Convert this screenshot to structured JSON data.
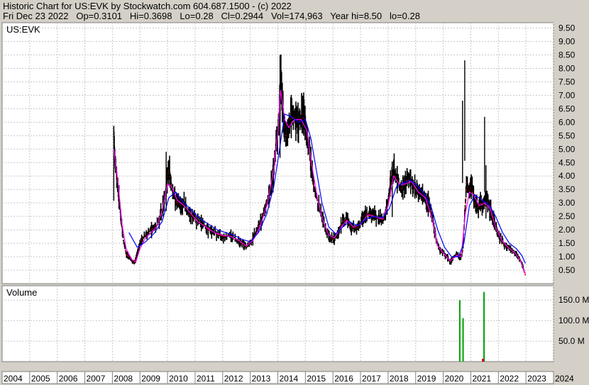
{
  "header": {
    "line1": "Historic Chart for US:EVK by Stockwatch.com 604.687.1500 - (c) 2022",
    "line2": "Fri Dec 23 2022   Op=0.3101   Hi=0.3698   Lo=0.28   Cl=0.2944   Vol=174,963   Year hi=8.50   lo=0.28"
  },
  "colors": {
    "background": "#d4d0c8",
    "plot_bg": "#ffffff",
    "grid": "#c8c8c8",
    "price_bars": "#000000",
    "ma_short": "#ff00ff",
    "ma_long": "#0000ff",
    "volume_bars": "#00a000"
  },
  "chart_data": [
    {
      "type": "line",
      "title": "US:EVK",
      "xlabel": "",
      "ylabel": "",
      "x_range": [
        2004.0,
        2024.0
      ],
      "ylim": [
        0,
        9.7
      ],
      "y_ticks": [
        0.5,
        1.0,
        1.5,
        2.0,
        2.5,
        3.0,
        3.5,
        4.0,
        4.5,
        5.0,
        5.5,
        6.0,
        6.5,
        7.0,
        7.5,
        8.0,
        8.5,
        9.0,
        9.5
      ],
      "y_tick_labels": [
        "0.50",
        "1.00",
        "1.50",
        "2.00",
        "2.50",
        "3.00",
        "3.50",
        "4.00",
        "4.50",
        "5.00",
        "5.50",
        "6.00",
        "6.50",
        "7.00",
        "7.50",
        "8.00",
        "8.50",
        "9.00",
        "9.50"
      ],
      "grid": true,
      "series": [
        {
          "name": "",
          "style": "hi-lo price bars",
          "color": "#000000",
          "points": [
            [
              2008.05,
              5.5
            ],
            [
              2008.12,
              4.3
            ],
            [
              2008.2,
              3.6
            ],
            [
              2008.3,
              2.5
            ],
            [
              2008.4,
              1.6
            ],
            [
              2008.5,
              1.1
            ],
            [
              2008.6,
              1.0
            ],
            [
              2008.7,
              0.85
            ],
            [
              2008.8,
              0.75
            ],
            [
              2008.9,
              1.1
            ],
            [
              2009.0,
              1.5
            ],
            [
              2009.1,
              1.7
            ],
            [
              2009.25,
              1.8
            ],
            [
              2009.4,
              2.0
            ],
            [
              2009.55,
              2.1
            ],
            [
              2009.7,
              2.4
            ],
            [
              2009.85,
              2.9
            ],
            [
              2009.95,
              3.6
            ],
            [
              2010.05,
              4.2
            ],
            [
              2010.15,
              3.6
            ],
            [
              2010.3,
              3.1
            ],
            [
              2010.45,
              2.9
            ],
            [
              2010.6,
              3.0
            ],
            [
              2010.75,
              2.6
            ],
            [
              2010.9,
              2.5
            ],
            [
              2011.1,
              2.3
            ],
            [
              2011.3,
              2.2
            ],
            [
              2011.5,
              2.0
            ],
            [
              2011.7,
              1.9
            ],
            [
              2011.9,
              1.8
            ],
            [
              2012.1,
              1.75
            ],
            [
              2012.3,
              1.8
            ],
            [
              2012.5,
              1.65
            ],
            [
              2012.7,
              1.5
            ],
            [
              2012.85,
              1.35
            ],
            [
              2013.0,
              1.5
            ],
            [
              2013.15,
              1.8
            ],
            [
              2013.3,
              2.1
            ],
            [
              2013.45,
              2.5
            ],
            [
              2013.6,
              3.0
            ],
            [
              2013.75,
              3.5
            ],
            [
              2013.85,
              4.3
            ],
            [
              2013.95,
              5.2
            ],
            [
              2014.05,
              6.3
            ],
            [
              2014.1,
              7.6
            ],
            [
              2014.2,
              6.2
            ],
            [
              2014.3,
              5.4
            ],
            [
              2014.45,
              6.1
            ],
            [
              2014.6,
              6.2
            ],
            [
              2014.75,
              5.9
            ],
            [
              2014.9,
              6.3
            ],
            [
              2015.0,
              5.9
            ],
            [
              2015.1,
              5.3
            ],
            [
              2015.2,
              4.5
            ],
            [
              2015.3,
              3.7
            ],
            [
              2015.45,
              3.0
            ],
            [
              2015.6,
              2.5
            ],
            [
              2015.75,
              2.0
            ],
            [
              2015.9,
              1.7
            ],
            [
              2016.05,
              1.65
            ],
            [
              2016.2,
              1.9
            ],
            [
              2016.35,
              2.3
            ],
            [
              2016.5,
              2.4
            ],
            [
              2016.65,
              2.1
            ],
            [
              2016.8,
              2.05
            ],
            [
              2016.95,
              2.1
            ],
            [
              2017.1,
              2.5
            ],
            [
              2017.25,
              2.6
            ],
            [
              2017.4,
              2.55
            ],
            [
              2017.55,
              2.5
            ],
            [
              2017.7,
              2.4
            ],
            [
              2017.85,
              2.4
            ],
            [
              2018.0,
              3.0
            ],
            [
              2018.1,
              3.8
            ],
            [
              2018.2,
              4.2
            ],
            [
              2018.35,
              3.8
            ],
            [
              2018.5,
              3.5
            ],
            [
              2018.65,
              3.8
            ],
            [
              2018.8,
              3.9
            ],
            [
              2018.95,
              3.6
            ],
            [
              2019.1,
              3.4
            ],
            [
              2019.25,
              3.3
            ],
            [
              2019.4,
              3.1
            ],
            [
              2019.55,
              2.7
            ],
            [
              2019.65,
              2.2
            ],
            [
              2019.75,
              1.6
            ],
            [
              2019.85,
              1.3
            ],
            [
              2019.95,
              1.2
            ],
            [
              2020.05,
              1.1
            ],
            [
              2020.15,
              1.0
            ],
            [
              2020.25,
              0.8
            ],
            [
              2020.35,
              0.95
            ],
            [
              2020.5,
              1.1
            ],
            [
              2020.6,
              0.95
            ],
            [
              2020.7,
              1.2
            ],
            [
              2020.78,
              2.5
            ],
            [
              2020.85,
              3.8
            ],
            [
              2020.95,
              3.4
            ],
            [
              2021.05,
              3.6
            ],
            [
              2021.15,
              3.0
            ],
            [
              2021.25,
              2.8
            ],
            [
              2021.35,
              3.0
            ],
            [
              2021.45,
              2.9
            ],
            [
              2021.55,
              3.2
            ],
            [
              2021.65,
              2.9
            ],
            [
              2021.75,
              2.6
            ],
            [
              2021.85,
              2.3
            ],
            [
              2021.95,
              2.0
            ],
            [
              2022.05,
              1.7
            ],
            [
              2022.2,
              1.5
            ],
            [
              2022.35,
              1.35
            ],
            [
              2022.5,
              1.25
            ],
            [
              2022.65,
              1.1
            ],
            [
              2022.8,
              0.85
            ],
            [
              2022.9,
              0.6
            ],
            [
              2022.98,
              0.29
            ]
          ]
        },
        {
          "name": "",
          "style": "short moving average",
          "color": "#ff00ff",
          "points": [
            [
              2008.05,
              5.0
            ],
            [
              2008.2,
              3.8
            ],
            [
              2008.35,
              2.2
            ],
            [
              2008.5,
              1.3
            ],
            [
              2008.7,
              0.9
            ],
            [
              2008.85,
              0.8
            ],
            [
              2009.0,
              1.3
            ],
            [
              2009.2,
              1.7
            ],
            [
              2009.4,
              1.9
            ],
            [
              2009.6,
              2.1
            ],
            [
              2009.8,
              2.7
            ],
            [
              2010.0,
              3.7
            ],
            [
              2010.15,
              3.6
            ],
            [
              2010.35,
              3.1
            ],
            [
              2010.6,
              2.9
            ],
            [
              2010.85,
              2.6
            ],
            [
              2011.1,
              2.3
            ],
            [
              2011.4,
              2.1
            ],
            [
              2011.7,
              1.9
            ],
            [
              2012.0,
              1.8
            ],
            [
              2012.3,
              1.75
            ],
            [
              2012.6,
              1.6
            ],
            [
              2012.85,
              1.4
            ],
            [
              2013.1,
              1.6
            ],
            [
              2013.35,
              2.1
            ],
            [
              2013.6,
              2.9
            ],
            [
              2013.85,
              4.2
            ],
            [
              2014.0,
              5.6
            ],
            [
              2014.1,
              7.2
            ],
            [
              2014.25,
              6.1
            ],
            [
              2014.4,
              5.8
            ],
            [
              2014.6,
              6.1
            ],
            [
              2014.85,
              6.1
            ],
            [
              2015.05,
              5.7
            ],
            [
              2015.25,
              4.3
            ],
            [
              2015.45,
              3.1
            ],
            [
              2015.65,
              2.3
            ],
            [
              2015.85,
              1.8
            ],
            [
              2016.05,
              1.7
            ],
            [
              2016.3,
              2.1
            ],
            [
              2016.5,
              2.35
            ],
            [
              2016.75,
              2.1
            ],
            [
              2017.0,
              2.2
            ],
            [
              2017.25,
              2.55
            ],
            [
              2017.5,
              2.5
            ],
            [
              2017.8,
              2.4
            ],
            [
              2018.0,
              2.9
            ],
            [
              2018.2,
              4.0
            ],
            [
              2018.4,
              3.7
            ],
            [
              2018.6,
              3.7
            ],
            [
              2018.85,
              3.8
            ],
            [
              2019.1,
              3.4
            ],
            [
              2019.35,
              3.2
            ],
            [
              2019.6,
              2.4
            ],
            [
              2019.8,
              1.4
            ],
            [
              2020.0,
              1.15
            ],
            [
              2020.25,
              0.85
            ],
            [
              2020.5,
              1.05
            ],
            [
              2020.65,
              1.0
            ],
            [
              2020.8,
              2.6
            ],
            [
              2020.95,
              3.4
            ],
            [
              2021.1,
              3.3
            ],
            [
              2021.3,
              2.9
            ],
            [
              2021.5,
              3.0
            ],
            [
              2021.7,
              2.8
            ],
            [
              2021.9,
              2.1
            ],
            [
              2022.1,
              1.65
            ],
            [
              2022.35,
              1.35
            ],
            [
              2022.6,
              1.15
            ],
            [
              2022.8,
              0.85
            ],
            [
              2022.98,
              0.35
            ]
          ]
        },
        {
          "name": "",
          "style": "long moving average",
          "color": "#0000ff",
          "points": [
            [
              2008.6,
              1.9
            ],
            [
              2008.9,
              1.35
            ],
            [
              2009.2,
              1.55
            ],
            [
              2009.5,
              1.85
            ],
            [
              2009.8,
              2.3
            ],
            [
              2010.05,
              3.2
            ],
            [
              2010.3,
              3.4
            ],
            [
              2010.6,
              3.0
            ],
            [
              2010.9,
              2.7
            ],
            [
              2011.2,
              2.4
            ],
            [
              2011.5,
              2.2
            ],
            [
              2011.8,
              2.0
            ],
            [
              2012.1,
              1.9
            ],
            [
              2012.4,
              1.8
            ],
            [
              2012.7,
              1.65
            ],
            [
              2013.0,
              1.55
            ],
            [
              2013.3,
              1.9
            ],
            [
              2013.6,
              2.6
            ],
            [
              2013.85,
              3.6
            ],
            [
              2014.05,
              4.9
            ],
            [
              2014.25,
              6.3
            ],
            [
              2014.5,
              6.2
            ],
            [
              2014.75,
              6.0
            ],
            [
              2015.0,
              6.1
            ],
            [
              2015.2,
              5.4
            ],
            [
              2015.4,
              4.2
            ],
            [
              2015.6,
              3.0
            ],
            [
              2015.85,
              2.1
            ],
            [
              2016.1,
              1.85
            ],
            [
              2016.35,
              2.1
            ],
            [
              2016.6,
              2.3
            ],
            [
              2016.9,
              2.15
            ],
            [
              2017.2,
              2.4
            ],
            [
              2017.5,
              2.5
            ],
            [
              2017.8,
              2.45
            ],
            [
              2018.05,
              2.8
            ],
            [
              2018.3,
              3.6
            ],
            [
              2018.55,
              3.75
            ],
            [
              2018.8,
              3.85
            ],
            [
              2019.05,
              3.65
            ],
            [
              2019.3,
              3.35
            ],
            [
              2019.55,
              2.9
            ],
            [
              2019.8,
              2.0
            ],
            [
              2020.05,
              1.35
            ],
            [
              2020.3,
              1.0
            ],
            [
              2020.55,
              1.0
            ],
            [
              2020.75,
              1.5
            ],
            [
              2020.95,
              2.9
            ],
            [
              2021.15,
              3.3
            ],
            [
              2021.4,
              3.1
            ],
            [
              2021.65,
              2.95
            ],
            [
              2021.9,
              2.5
            ],
            [
              2022.15,
              1.9
            ],
            [
              2022.4,
              1.5
            ],
            [
              2022.65,
              1.3
            ],
            [
              2022.85,
              1.05
            ],
            [
              2022.98,
              0.75
            ]
          ]
        }
      ],
      "spikes": [
        [
          2008.05,
          5.6
        ],
        [
          2009.95,
          4.9
        ],
        [
          2014.08,
          8.5
        ],
        [
          2018.15,
          4.5
        ],
        [
          2020.7,
          6.8
        ],
        [
          2020.78,
          8.3
        ],
        [
          2021.5,
          6.2
        ],
        [
          2021.55,
          4.4
        ]
      ]
    },
    {
      "type": "bar",
      "title": "Volume",
      "xlabel": "",
      "ylabel": "",
      "ylim": [
        0,
        185
      ],
      "y_ticks": [
        50,
        100,
        150
      ],
      "y_tick_labels": [
        "50.0 M",
        "100.0 M",
        "150.0 M"
      ],
      "grid": true,
      "x": [
        2020.6,
        2020.72,
        2021.48
      ],
      "values": [
        150,
        106,
        170
      ]
    }
  ],
  "x_axis": {
    "labels": [
      "2004",
      "2005",
      "2006",
      "2007",
      "2008",
      "2009",
      "2010",
      "2011",
      "2012",
      "2013",
      "2014",
      "2015",
      "2016",
      "2017",
      "2018",
      "2019",
      "2020",
      "2021",
      "2022",
      "2023",
      "2024"
    ]
  }
}
